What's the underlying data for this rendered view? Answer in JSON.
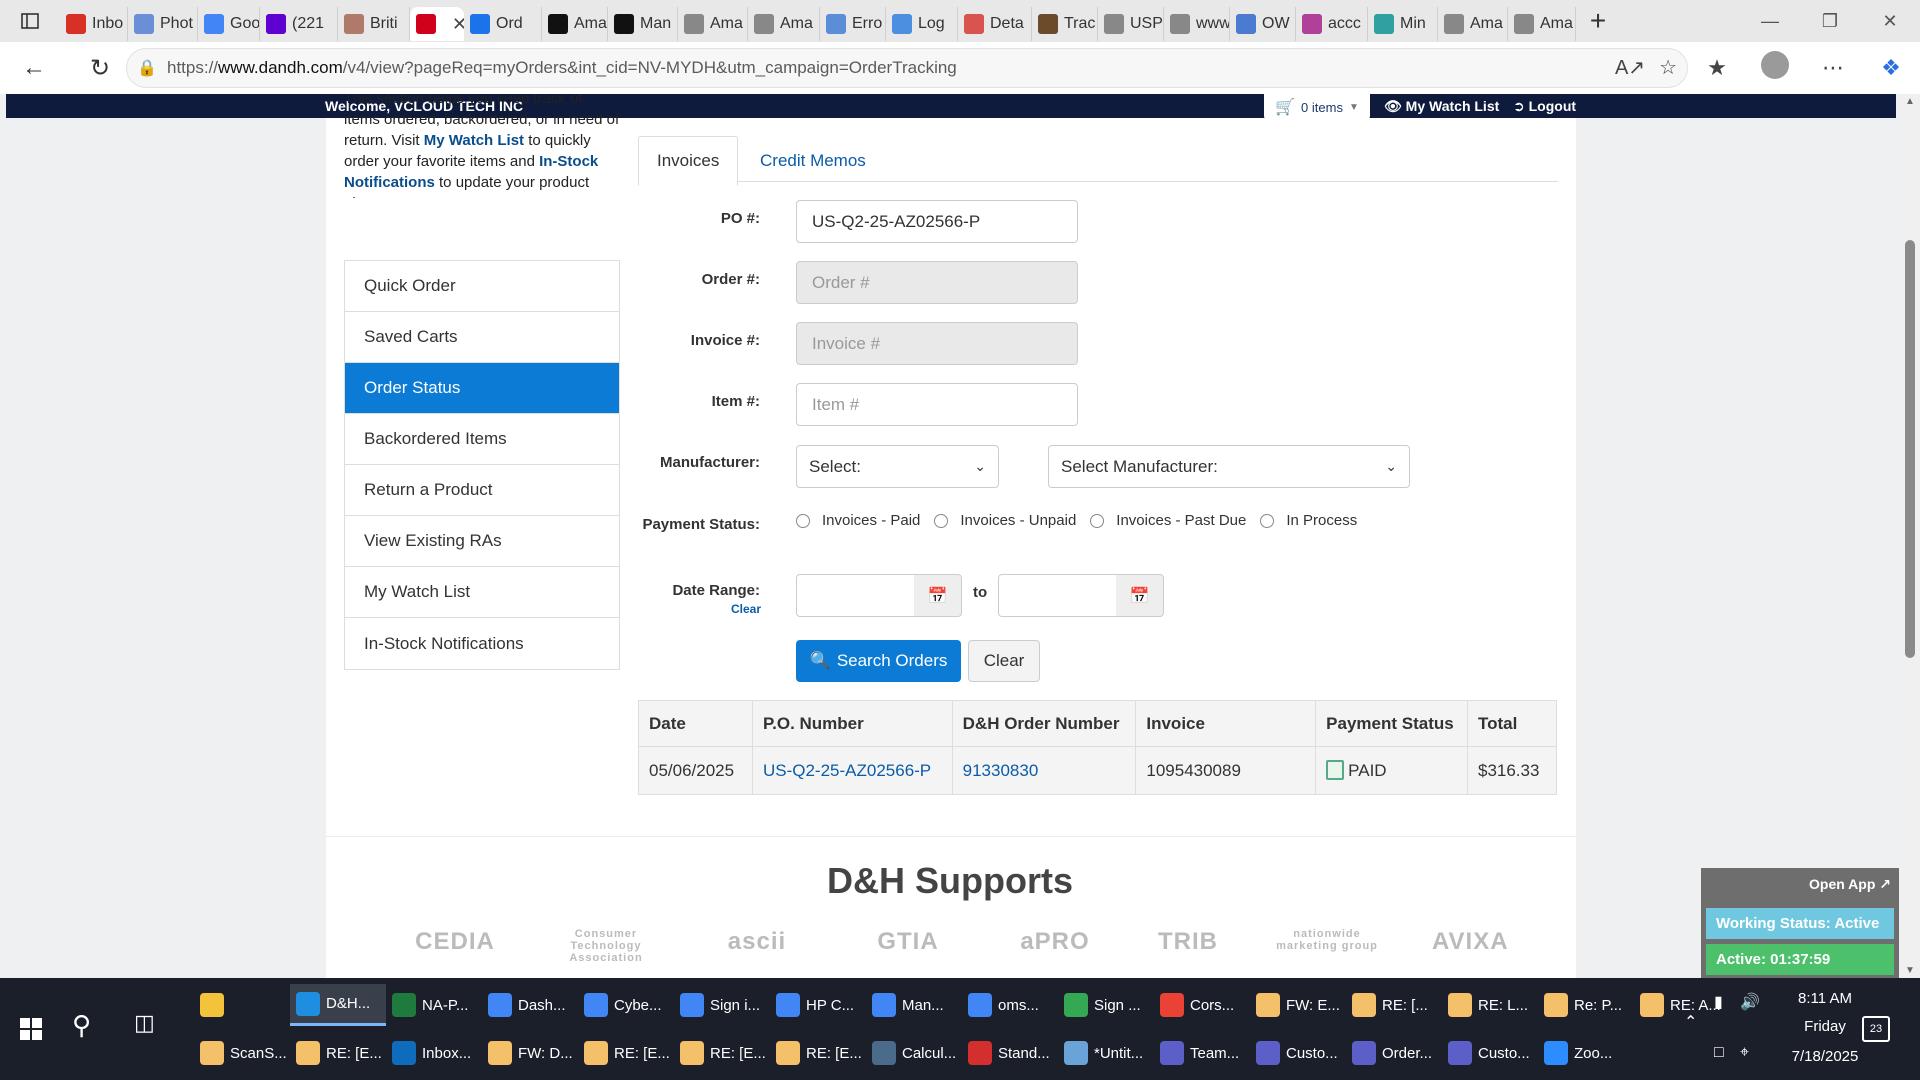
{
  "browser": {
    "tabs": [
      {
        "label": "Inbo",
        "icon": "gmail-icon",
        "color": "#d93025"
      },
      {
        "label": "Phot",
        "icon": "photos-icon",
        "color": "#6b8fd6"
      },
      {
        "label": "Goo",
        "icon": "google-icon",
        "color": "#4285f4"
      },
      {
        "label": "(221",
        "icon": "yahoo-mail-icon",
        "color": "#5f01d1"
      },
      {
        "label": "Briti",
        "icon": "british-icon",
        "color": "#b07a6a"
      },
      {
        "label": "",
        "icon": "dandh-icon",
        "color": "#d0021b",
        "active": true
      },
      {
        "label": "Ord",
        "icon": "ec-icon",
        "color": "#1a73e8"
      },
      {
        "label": "Ama",
        "icon": "amazon-icon",
        "color": "#111111"
      },
      {
        "label": "Man",
        "icon": "amazon-icon",
        "color": "#111111"
      },
      {
        "label": "Ama",
        "icon": "amazon-icon",
        "color": "#888888"
      },
      {
        "label": "Ama",
        "icon": "amazon-icon",
        "color": "#888888"
      },
      {
        "label": "Erro",
        "icon": "dell-icon",
        "color": "#5b8ed6"
      },
      {
        "label": "Log",
        "icon": "cloud-icon",
        "color": "#4a8fe0"
      },
      {
        "label": "Deta",
        "icon": "fedex-icon",
        "color": "#d9534f"
      },
      {
        "label": "Trac",
        "icon": "ups-icon",
        "color": "#6b4b2a"
      },
      {
        "label": "USP",
        "icon": "usps-icon",
        "color": "#888888"
      },
      {
        "label": "www",
        "icon": "page-icon",
        "color": "#888888"
      },
      {
        "label": "OW",
        "icon": "ow-icon",
        "color": "#4a7bd0"
      },
      {
        "label": "accc",
        "icon": "acc-icon",
        "color": "#b0409a"
      },
      {
        "label": "Min",
        "icon": "mint-icon",
        "color": "#30a0a0"
      },
      {
        "label": "Ama",
        "icon": "amazon-icon",
        "color": "#888888"
      },
      {
        "label": "Ama",
        "icon": "amazon-icon",
        "color": "#888888"
      }
    ],
    "url_prefix": "https://",
    "url_host": "www.dandh.com",
    "url_path": "/v4/view?pageReq=myOrders&int_cid=NV-MYDH&utm_campaign=OrderTracking"
  },
  "topnav": {
    "welcome": "Welcome, VCLOUD TECH INC",
    "cart": "0 items",
    "watch_list": "My Watch List",
    "logout": "Logout"
  },
  "intro": {
    "line_pre": "This section helps you keep track of items ordered, backordered, or in need of return. Visit ",
    "watch_link": "My Watch List",
    "line_mid": " to quickly order your favorite items and ",
    "instock_link": "In-Stock Notifications",
    "line_post": " to update your product alerts."
  },
  "sidemenu": [
    {
      "label": "Quick Order"
    },
    {
      "label": "Saved Carts"
    },
    {
      "label": "Order Status",
      "active": true
    },
    {
      "label": "Backordered Items"
    },
    {
      "label": "Return a Product"
    },
    {
      "label": "View Existing RAs"
    },
    {
      "label": "My Watch List"
    },
    {
      "label": "In-Stock Notifications"
    }
  ],
  "tabs": {
    "invoices": "Invoices",
    "credit_memos": "Credit Memos"
  },
  "form": {
    "po_label": "PO #:",
    "po_value": "US-Q2-25-AZ02566-P",
    "order_label": "Order #:",
    "order_placeholder": "Order #",
    "invoice_label": "Invoice #:",
    "invoice_placeholder": "Invoice #",
    "item_label": "Item #:",
    "item_placeholder": "Item #",
    "manufacturer_label": "Manufacturer:",
    "manufacturer_select": "Select:",
    "manufacturer_select2": "Select Manufacturer:",
    "payment_label": "Payment Status:",
    "payment_options": [
      "Invoices - Paid",
      "Invoices - Unpaid",
      "Invoices - Past Due",
      "In Process"
    ],
    "date_label": "Date Range:",
    "date_clear": "Clear",
    "date_to": "to",
    "search_button": "Search Orders",
    "clear_button": "Clear"
  },
  "results": {
    "headers": [
      "Date",
      "P.O. Number",
      "D&H Order Number",
      "Invoice",
      "Payment Status",
      "Total"
    ],
    "rows": [
      [
        "05/06/2025",
        "US-Q2-25-AZ02566-P",
        "91330830",
        "1095430089",
        "PAID",
        "$316.33"
      ]
    ]
  },
  "supports": {
    "title": "D&H Supports",
    "partners": [
      "CEDIA",
      "Consumer Technology Association",
      "ascii",
      "GTIA",
      "aPRO",
      "TRIB",
      "nationwide marketing group",
      "AVIXA"
    ]
  },
  "widget": {
    "open_app": "Open App ↗",
    "working_status": "Working Status: Active",
    "active_time": "Active: 01:37:59"
  },
  "taskbar": {
    "row1": [
      {
        "label": "",
        "color": "#f3c33c",
        "icon": "file-explorer-icon"
      },
      {
        "label": "D&H...",
        "color": "#1e8fe0",
        "icon": "edge-icon",
        "active": true
      },
      {
        "label": "NA-P...",
        "color": "#1f7a3e",
        "icon": "excel-icon"
      },
      {
        "label": "Dash...",
        "color": "#4285f4",
        "icon": "chrome-icon"
      },
      {
        "label": "Cybe...",
        "color": "#4285f4",
        "icon": "chrome-icon"
      },
      {
        "label": "Sign i...",
        "color": "#4285f4",
        "icon": "chrome-icon"
      },
      {
        "label": "HP C...",
        "color": "#4285f4",
        "icon": "chrome-icon"
      },
      {
        "label": "Man...",
        "color": "#4285f4",
        "icon": "chrome-icon"
      },
      {
        "label": "oms...",
        "color": "#4285f4",
        "icon": "chrome-icon"
      },
      {
        "label": "Sign ...",
        "color": "#34a853",
        "icon": "chrome-icon"
      },
      {
        "label": "Cors...",
        "color": "#ea4335",
        "icon": "chrome-icon"
      },
      {
        "label": "FW: E...",
        "color": "#f4c06a",
        "icon": "mail-icon"
      },
      {
        "label": "RE: [...",
        "color": "#f4c06a",
        "icon": "mail-icon"
      },
      {
        "label": "RE: L...",
        "color": "#f4c06a",
        "icon": "mail-icon"
      },
      {
        "label": "Re: P...",
        "color": "#f4c06a",
        "icon": "mail-icon"
      },
      {
        "label": "RE: A...",
        "color": "#f4c06a",
        "icon": "mail-icon"
      }
    ],
    "row2": [
      {
        "label": "ScanS...",
        "color": "#f4c06a",
        "icon": "mail-icon"
      },
      {
        "label": "RE: [E...",
        "color": "#f4c06a",
        "icon": "mail-icon"
      },
      {
        "label": "Inbox...",
        "color": "#0f6cbd",
        "icon": "outlook-icon"
      },
      {
        "label": "FW: D...",
        "color": "#f4c06a",
        "icon": "mail-icon"
      },
      {
        "label": "RE: [E...",
        "color": "#f4c06a",
        "icon": "mail-icon"
      },
      {
        "label": "RE: [E...",
        "color": "#f4c06a",
        "icon": "mail-icon"
      },
      {
        "label": "RE: [E...",
        "color": "#f4c06a",
        "icon": "mail-icon"
      },
      {
        "label": "Calcul...",
        "color": "#4a6b8a",
        "icon": "calculator-icon"
      },
      {
        "label": "Stand...",
        "color": "#d32f2f",
        "icon": "pdf-icon"
      },
      {
        "label": "*Untit...",
        "color": "#6aa3d8",
        "icon": "notepad-icon"
      },
      {
        "label": "Team...",
        "color": "#5b5fc7",
        "icon": "teams-icon"
      },
      {
        "label": "Custo...",
        "color": "#5b5fc7",
        "icon": "teams-icon"
      },
      {
        "label": "Order...",
        "color": "#5b5fc7",
        "icon": "teams-icon"
      },
      {
        "label": "Custo...",
        "color": "#5b5fc7",
        "icon": "teams-icon"
      },
      {
        "label": "Zoo...",
        "color": "#2d8cff",
        "icon": "zoom-icon"
      }
    ],
    "time": "8:11 AM",
    "day": "Friday",
    "date": "7/18/2025",
    "notifications": "23"
  }
}
